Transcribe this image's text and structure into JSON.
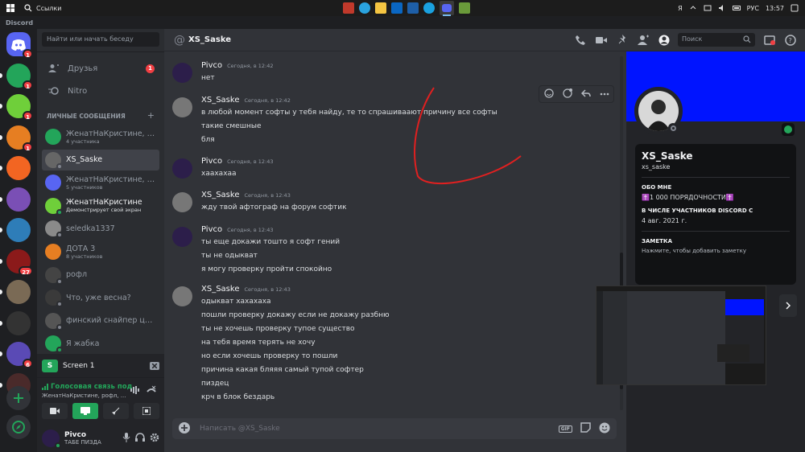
{
  "taskbar": {
    "search_label": "Ссылки",
    "lang": "РУС",
    "tray_letter": "Я",
    "time": "13:57"
  },
  "app_title": "Discord",
  "servers": [
    {
      "badge": "1",
      "color": "#5865f2"
    },
    {
      "badge": "1",
      "color": "#23a55a"
    },
    {
      "badge": "1",
      "color": "#6fcf3a"
    },
    {
      "badge": "1",
      "color": "#e67e22"
    },
    {
      "badge": "",
      "color": "#f26522"
    },
    {
      "badge": "",
      "color": "#7a4fb5"
    },
    {
      "badge": "",
      "color": "#2e7db8"
    },
    {
      "badge": "27",
      "color": "#8b1a1a"
    },
    {
      "badge": "",
      "color": "#7a6a55"
    },
    {
      "badge": "",
      "color": "#333"
    },
    {
      "badge": "6",
      "color": "#5a4ab5"
    },
    {
      "badge": "",
      "color": "#4a2a2a"
    }
  ],
  "sidebar": {
    "search_placeholder": "Найти или начать беседу",
    "friends_label": "Друзья",
    "friends_badge": "1",
    "nitro_label": "Nitro",
    "dm_header": "ЛИЧНЫЕ СООБЩЕНИЯ",
    "add_symbol": "+",
    "items": [
      {
        "name": "ЖенатНаКристине, р...",
        "sub": "4 участника",
        "color": "#23a55a"
      },
      {
        "name": "XS_Saske",
        "sub": "",
        "color": "#666"
      },
      {
        "name": "ЖенатНаКристине, Я...",
        "sub": "5 участников",
        "color": "#5865f2"
      },
      {
        "name": "ЖенатНаКристине",
        "sub": "Демонстрирует свой экран",
        "color": "#6fcf3a"
      },
      {
        "name": "seledka1337",
        "sub": "",
        "color": "#8a8a8a"
      },
      {
        "name": "ДОТА 3",
        "sub": "8 участников",
        "color": "#e67e22"
      },
      {
        "name": "рофл",
        "sub": "",
        "color": "#444"
      },
      {
        "name": "Что, уже весна?",
        "sub": "",
        "color": "#3a3a3a"
      },
      {
        "name": "финский снайпер це...",
        "sub": "",
        "color": "#555"
      },
      {
        "name": "Я жабка",
        "sub": "",
        "color": "#23a55a"
      }
    ]
  },
  "screen_panel": {
    "label": "Screen 1",
    "icon_letter": "S"
  },
  "voice": {
    "status": "Голосовая связь под",
    "channel": "ЖенатНаКристине, рофл, ..."
  },
  "user": {
    "name": "Pivco",
    "status": "ТАБЕ ПИЗДА"
  },
  "chat": {
    "header_name": "XS_Saske",
    "search_placeholder": "Поиск",
    "composer_placeholder": "Написать @XS_Saske",
    "gif_label": "GIF",
    "messages": [
      {
        "author": "Pivco",
        "time": "Сегодня, в 12:42",
        "lines": [
          "нет"
        ],
        "av": "#2c1e4a"
      },
      {
        "author": "XS_Saske",
        "time": "Сегодня, в 12:42",
        "lines": [
          "в любой момент софты у тебя найду, те то спрашиваают причину все софты",
          "такие смешные",
          "бля"
        ],
        "av": "#777"
      },
      {
        "author": "Pivco",
        "time": "Сегодня, в 12:43",
        "lines": [
          "хаахахаа"
        ],
        "av": "#2c1e4a"
      },
      {
        "author": "XS_Saske",
        "time": "Сегодня, в 12:43",
        "lines": [
          "жду твой афтограф на форум софтик"
        ],
        "av": "#777"
      },
      {
        "author": "Pivco",
        "time": "Сегодня, в 12:43",
        "lines": [
          "ты еще докажи тошто я софт гений",
          "ты не одыкват",
          "я могу проверку пройти спокойно"
        ],
        "av": "#2c1e4a"
      },
      {
        "author": "XS_Saske",
        "time": "Сегодня, в 12:43",
        "lines": [
          "одыкват хахахаха",
          "пошли проверку докажу если не докажу разбню",
          "ты не хочешь проверку тупое существо",
          "на тебя время терять не хочу",
          "но если хочешь проверку то пошли",
          "причина какая бляяя самый тупой софтер",
          "пиздец",
          "крч в блок бездарь"
        ],
        "av": "#777"
      }
    ]
  },
  "profile": {
    "banner_color": "#0014ff",
    "name": "XS_Saske",
    "handle": "xs_saske",
    "about_heading": "ОБО МНЕ",
    "about_text": "✝️1 000 ПОРЯДОЧНОСТИ✝️",
    "member_heading": "В ЧИСЛЕ УЧАСТНИКОВ DISCORD С",
    "member_since": "4 авг. 2021 г.",
    "note_heading": "ЗАМЕТКА",
    "note_placeholder": "Нажмите, чтобы добавить заметку"
  }
}
